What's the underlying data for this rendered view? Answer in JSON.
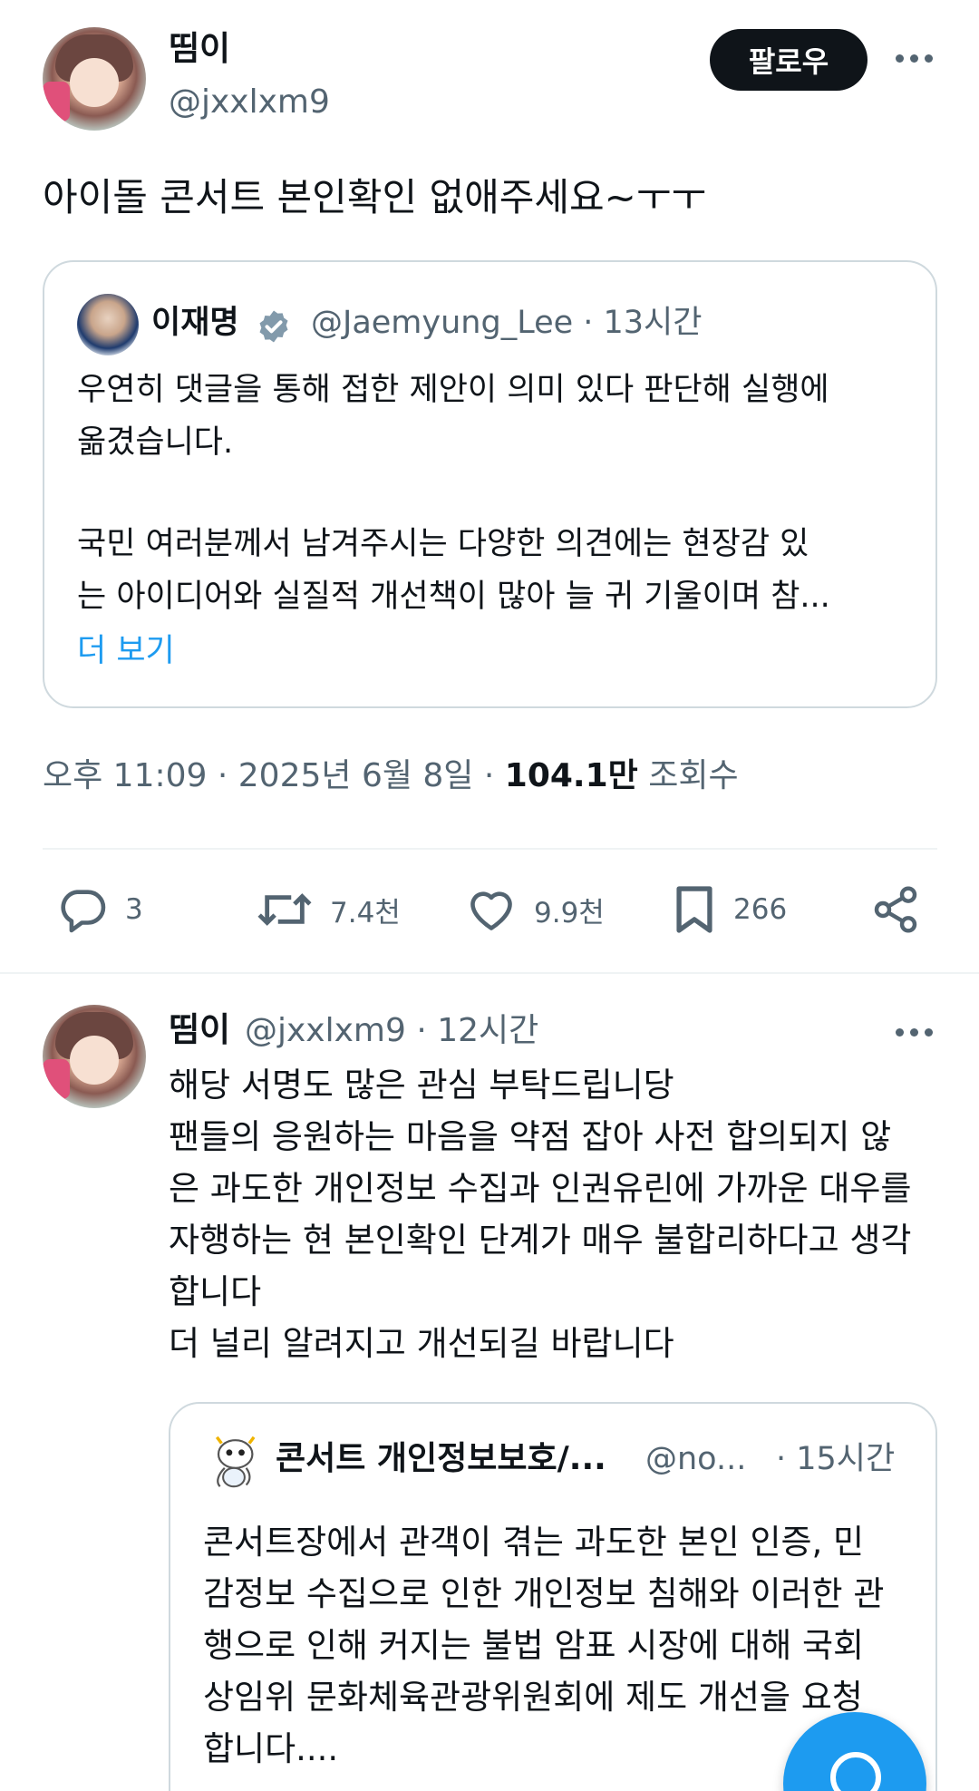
{
  "post": {
    "author_name": "띰이",
    "author_handle": "@jxxlxm9",
    "follow_label": "팔로우",
    "text": "아이돌 콘서트 본인확인 없애주세요~ㅜㅜ"
  },
  "quoted": {
    "name": "이재명",
    "handle_time": "@Jaemyung_Lee · 13시간",
    "lines": [
      "우연히 댓글을 통해 접한 제안이 의미 있다 판단해 실행에",
      "옮겼습니다.",
      "",
      "국민 여러분께서 남겨주시는 다양한 의견에는 현장감 있",
      "는 아이디어와 실질적 개선책이 많아 늘 귀 기울이며 참..."
    ],
    "more_label": "더 보기"
  },
  "meta": {
    "time": "오후 11:09 · 2025년 6월 8일 · ",
    "views_count": "104.1만",
    "views_label": "조회수"
  },
  "actions": {
    "reply": "3",
    "repost": "7.4천",
    "like": "9.9천",
    "bookmark": "266"
  },
  "reply": {
    "author_name": "띰이",
    "handle_time": "@jxxlxm9 · 12시간",
    "lines": [
      "해당 서명도 많은 관심 부탁드립니당",
      "팬들의 응원하는 마음을 약점 잡아 사전 합의되지 않",
      "은 과도한 개인정보 수집과 인권유린에 가까운 대우를",
      "자행하는 현 본인확인 단계가 매우 불합리하다고 생각",
      "합니다",
      "더 널리 알려지고 개선되길 바랍니다"
    ],
    "quoted": {
      "name": "콘서트 개인정보보호/...",
      "handle": "@no...",
      "time": "· 15시간",
      "lines": [
        "콘서트장에서 관객이 겪는 과도한 본인 인증, 민",
        "감정보 수집으로 인한 개인정보 침해와 이러한 관",
        "행으로 인해 커지는 불법 암표 시장에 대해 국회",
        "상임위 문화체육관광위원회에 제도 개선을 요청",
        "합니다...."
      ]
    }
  },
  "colors": {
    "accent": "#1d9bf0",
    "text": "#0f1419",
    "secondary": "#536471",
    "border": "#cfd9de"
  }
}
